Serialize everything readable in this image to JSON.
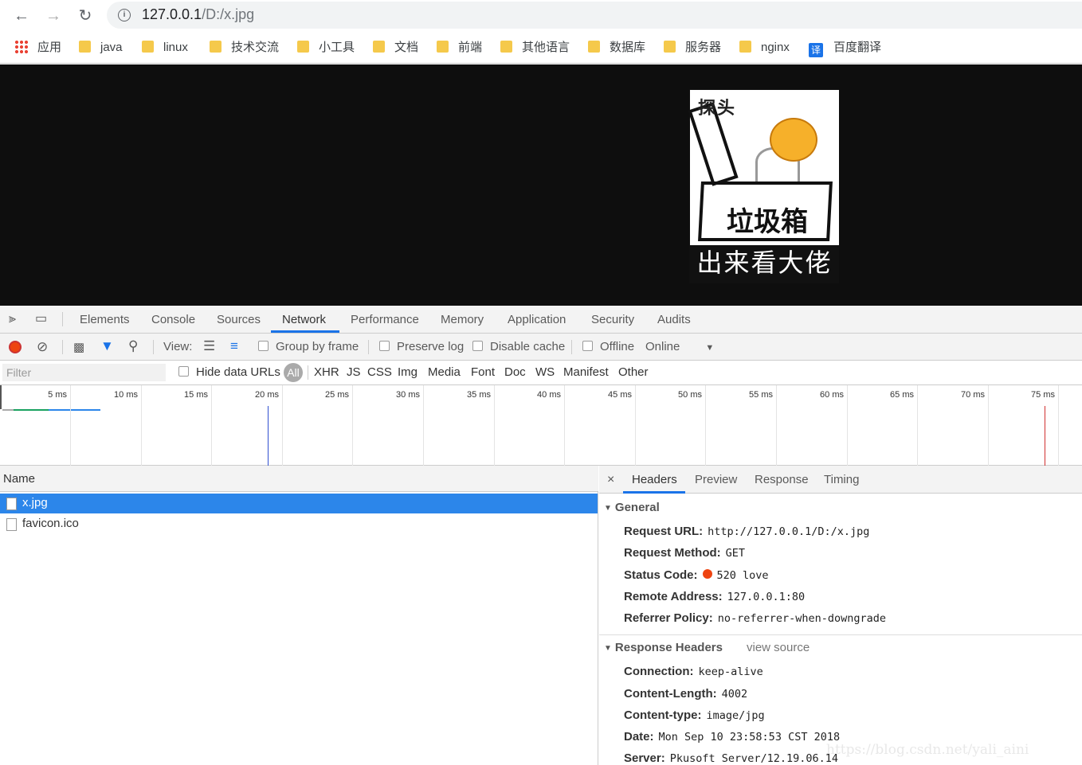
{
  "browser": {
    "url_main": "127.0.0.1",
    "url_rest": "/D:/x.jpg",
    "back_icon": "back-arrow-icon",
    "forward_icon": "forward-arrow-icon",
    "reload_icon": "reload-icon"
  },
  "bookmarks": [
    {
      "label": "应用"
    },
    {
      "label": "java"
    },
    {
      "label": "linux"
    },
    {
      "label": "技术交流"
    },
    {
      "label": "小工具"
    },
    {
      "label": "文档"
    },
    {
      "label": "前端"
    },
    {
      "label": "其他语言"
    },
    {
      "label": "数据库"
    },
    {
      "label": "服务器"
    },
    {
      "label": "nginx"
    },
    {
      "label": "百度翻译",
      "badge": "译"
    }
  ],
  "image": {
    "top_text": "探头",
    "box_text": "垃圾箱",
    "caption": "出来看大佬"
  },
  "devtools": {
    "tabs": [
      "Elements",
      "Console",
      "Sources",
      "Network",
      "Performance",
      "Memory",
      "Application",
      "Security",
      "Audits"
    ],
    "active_tab": "Network",
    "toolbar": {
      "view_label": "View:",
      "group_by_frame": "Group by frame",
      "preserve_log": "Preserve log",
      "disable_cache": "Disable cache",
      "offline": "Offline",
      "online": "Online"
    },
    "filter": {
      "placeholder": "Filter",
      "hide_data_urls": "Hide data URLs",
      "all": "All",
      "types": [
        "XHR",
        "JS",
        "CSS",
        "Img",
        "Media",
        "Font",
        "Doc",
        "WS",
        "Manifest",
        "Other"
      ]
    },
    "timeline_ticks": [
      "5 ms",
      "10 ms",
      "15 ms",
      "20 ms",
      "25 ms",
      "30 ms",
      "35 ms",
      "40 ms",
      "45 ms",
      "50 ms",
      "55 ms",
      "60 ms",
      "65 ms",
      "70 ms",
      "75 ms"
    ],
    "name_header": "Name",
    "requests": [
      {
        "name": "x.jpg",
        "selected": true
      },
      {
        "name": "favicon.ico",
        "selected": false
      }
    ],
    "detail_tabs": [
      "Headers",
      "Preview",
      "Response",
      "Timing"
    ],
    "general": {
      "title": "General",
      "rows": [
        {
          "k": "Request URL:",
          "v": "http://127.0.0.1/D:/x.jpg"
        },
        {
          "k": "Request Method:",
          "v": "GET"
        },
        {
          "k": "Status Code:",
          "v": "520 love"
        },
        {
          "k": "Remote Address:",
          "v": "127.0.0.1:80"
        },
        {
          "k": "Referrer Policy:",
          "v": "no-referrer-when-downgrade"
        }
      ]
    },
    "response_headers": {
      "title": "Response Headers",
      "view_source": "view source",
      "rows": [
        {
          "k": "Connection:",
          "v": "keep-alive"
        },
        {
          "k": "Content-Length:",
          "v": "4002"
        },
        {
          "k": "Content-type:",
          "v": "image/jpg"
        },
        {
          "k": "Date:",
          "v": "Mon Sep 10 23:58:53 CST 2018"
        },
        {
          "k": "Server:",
          "v": "Pkusoft Server/12.19.06.14"
        }
      ]
    }
  },
  "watermark": "https://blog.csdn.net/yali_aini",
  "colors": {
    "accent": "#1a73e8",
    "selected_row": "#2c86ea",
    "record": "#e41"
  }
}
